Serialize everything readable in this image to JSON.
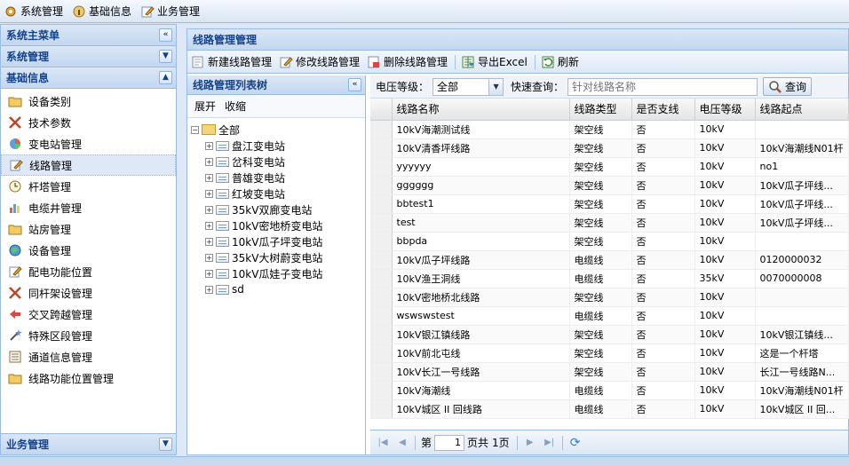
{
  "topbar": {
    "items": [
      {
        "label": "系统管理",
        "icon": "gear-icon"
      },
      {
        "label": "基础信息",
        "icon": "info-icon"
      },
      {
        "label": "业务管理",
        "icon": "edit-icon"
      }
    ]
  },
  "sidebar": {
    "main_menu_title": "系统主菜单",
    "system_title": "系统管理",
    "basic_title": "基础信息",
    "business_title": "业务管理",
    "items": [
      {
        "label": "设备类别",
        "icon": "folder-icon"
      },
      {
        "label": "技术参数",
        "icon": "tools-icon"
      },
      {
        "label": "变电站管理",
        "icon": "substation-icon"
      },
      {
        "label": "线路管理",
        "icon": "line-icon"
      },
      {
        "label": "杆塔管理",
        "icon": "clock-icon"
      },
      {
        "label": "电缆井管理",
        "icon": "chart-icon"
      },
      {
        "label": "站房管理",
        "icon": "folder-icon"
      },
      {
        "label": "设备管理",
        "icon": "globe-icon"
      },
      {
        "label": "配电功能位置",
        "icon": "edit-icon"
      },
      {
        "label": "同杆架设管理",
        "icon": "tools-icon"
      },
      {
        "label": "交叉跨越管理",
        "icon": "arrows-icon"
      },
      {
        "label": "特殊区段管理",
        "icon": "wand-icon"
      },
      {
        "label": "通道信息管理",
        "icon": "list-icon"
      },
      {
        "label": "线路功能位置管理",
        "icon": "folder-icon"
      }
    ],
    "active_index": 3
  },
  "main": {
    "title": "线路管理管理",
    "toolbar": {
      "new_label": "新建线路管理",
      "edit_label": "修改线路管理",
      "delete_label": "删除线路管理",
      "export_label": "导出Excel",
      "refresh_label": "刷新"
    }
  },
  "tree": {
    "title": "线路管理列表树",
    "expand_label": "展开",
    "collapse_label": "收缩",
    "root_label": "全部",
    "nodes": [
      "盘江变电站",
      "岔科变电站",
      "普雄变电站",
      "红坡变电站",
      "35kV双廊变电站",
      "10kV密地桥变电站",
      "10kV瓜子坪变电站",
      "35kV大树蔚变电站",
      "10kV瓜娃子变电站",
      "sd"
    ]
  },
  "search": {
    "voltage_label": "电压等级：",
    "voltage_value": "全部",
    "quick_label": "快速查询：",
    "placeholder": "针对线路名称",
    "button_label": "查询"
  },
  "grid": {
    "columns": [
      "线路名称",
      "线路类型",
      "是否支线",
      "电压等级",
      "线路起点"
    ],
    "rows": [
      [
        "10kV海潮测试线",
        "架空线",
        "否",
        "10kV",
        ""
      ],
      [
        "10kV清香坪线路",
        "架空线",
        "否",
        "10kV",
        "10kV海潮线N01杆"
      ],
      [
        "yyyyyy",
        "架空线",
        "否",
        "10kV",
        "no1"
      ],
      [
        "gggggg",
        "架空线",
        "否",
        "10kV",
        "10kV瓜子坪线..."
      ],
      [
        "bbtest1",
        "架空线",
        "否",
        "10kV",
        "10kV瓜子坪线..."
      ],
      [
        "test",
        "架空线",
        "否",
        "10kV",
        "10kV瓜子坪线..."
      ],
      [
        "bbpda",
        "架空线",
        "否",
        "10kV",
        ""
      ],
      [
        "10kV瓜子坪线路",
        "电缆线",
        "否",
        "10kV",
        "0120000032"
      ],
      [
        "10kV渔王洞线",
        "电缆线",
        "否",
        "35kV",
        "0070000008"
      ],
      [
        "10kV密地桥北线路",
        "架空线",
        "否",
        "10kV",
        ""
      ],
      [
        "wswswstest",
        "电缆线",
        "否",
        "10kV",
        ""
      ],
      [
        "10kV银江镇线路",
        "架空线",
        "否",
        "10kV",
        "10kV银江镇线..."
      ],
      [
        "10kV前北屯线",
        "架空线",
        "否",
        "10kV",
        "这是一个杆塔"
      ],
      [
        "10kV长江一号线路",
        "架空线",
        "否",
        "10kV",
        "长江一号线路N..."
      ],
      [
        "10kV海潮线",
        "电缆线",
        "否",
        "10kV",
        "10kV海潮线N01杆"
      ],
      [
        "10kV城区 II 回线路",
        "电缆线",
        "否",
        "10kV",
        "10kV城区 II 回..."
      ]
    ]
  },
  "pager": {
    "page_prefix": "第",
    "page_value": "1",
    "page_suffix": "页共",
    "total_pages": "1页"
  }
}
